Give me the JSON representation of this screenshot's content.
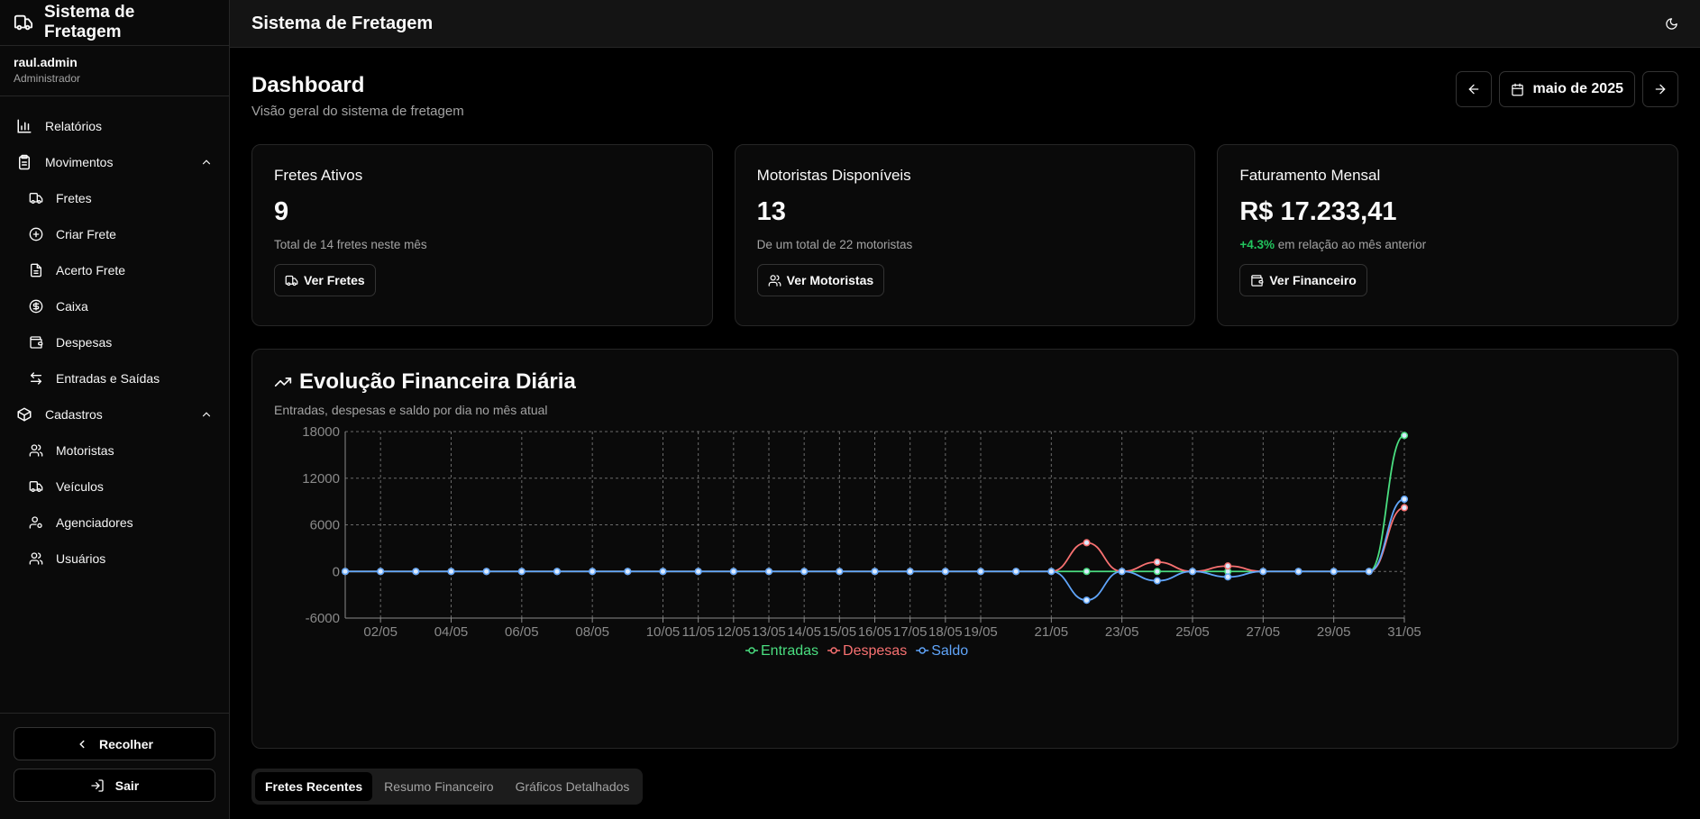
{
  "brand": {
    "title": "Sistema de Fretagem",
    "icon": "truck-icon"
  },
  "user": {
    "name": "raul.admin",
    "role": "Administrador"
  },
  "nav": {
    "relatorios": "Relatórios",
    "movimentos": "Movimentos",
    "fretes": "Fretes",
    "criar_frete": "Criar Frete",
    "acerto_frete": "Acerto Frete",
    "caixa": "Caixa",
    "despesas": "Despesas",
    "entradas_saidas": "Entradas e Saídas",
    "cadastros": "Cadastros",
    "motoristas": "Motoristas",
    "veiculos": "Veículos",
    "agenciadores": "Agenciadores",
    "usuarios": "Usuários"
  },
  "sidebar_footer": {
    "collapse": "Recolher",
    "logout": "Sair"
  },
  "topbar": {
    "title": "Sistema de Fretagem",
    "theme_icon": "moon-icon"
  },
  "page": {
    "title": "Dashboard",
    "subtitle": "Visão geral do sistema de fretagem",
    "month": "maio de 2025"
  },
  "cards": [
    {
      "label": "Fretes Ativos",
      "value": "9",
      "desc": "Total de 14 fretes neste mês",
      "button": "Ver Fretes",
      "icon": "truck-icon"
    },
    {
      "label": "Motoristas Disponíveis",
      "value": "13",
      "desc": "De um total de 22 motoristas",
      "button": "Ver Motoristas",
      "icon": "users-icon"
    },
    {
      "label": "Faturamento Mensal",
      "value": "R$ 17.233,41",
      "desc_highlight": "+4.3%",
      "desc": "em relação ao mês anterior",
      "button": "Ver Financeiro",
      "icon": "wallet-icon"
    }
  ],
  "chart_card": {
    "title": "Evolução Financeira Diária",
    "subtitle": "Entradas, despesas e saldo por dia no mês atual"
  },
  "colors": {
    "entradas": "#4ade80",
    "despesas": "#f87171",
    "saldo": "#60a5fa",
    "positive": "#22c55e"
  },
  "chart_data": {
    "type": "line",
    "x": [
      "01/05",
      "02/05",
      "03/05",
      "04/05",
      "05/05",
      "06/05",
      "07/05",
      "08/05",
      "09/05",
      "10/05",
      "11/05",
      "12/05",
      "13/05",
      "14/05",
      "15/05",
      "16/05",
      "17/05",
      "18/05",
      "19/05",
      "20/05",
      "21/05",
      "22/05",
      "23/05",
      "24/05",
      "25/05",
      "26/05",
      "27/05",
      "28/05",
      "29/05",
      "30/05",
      "31/05"
    ],
    "tick_labels": [
      "02/05",
      "04/05",
      "06/05",
      "08/05",
      "10/05",
      "11/05",
      "12/05",
      "13/05",
      "14/05",
      "15/05",
      "16/05",
      "17/05",
      "18/05",
      "19/05",
      "21/05",
      "23/05",
      "25/05",
      "27/05",
      "29/05",
      "31/05"
    ],
    "ylim": [
      -6000,
      18000
    ],
    "yticks": [
      18000,
      12000,
      6000,
      0,
      -6000
    ],
    "grid": true,
    "legend_position": "bottom-center",
    "series": [
      {
        "name": "Entradas",
        "values": [
          0,
          0,
          0,
          0,
          0,
          0,
          0,
          0,
          0,
          0,
          0,
          0,
          0,
          0,
          0,
          0,
          0,
          0,
          0,
          0,
          0,
          0,
          0,
          0,
          0,
          0,
          0,
          0,
          0,
          0,
          17500
        ]
      },
      {
        "name": "Despesas",
        "values": [
          0,
          0,
          0,
          0,
          0,
          0,
          0,
          0,
          0,
          0,
          0,
          0,
          0,
          0,
          0,
          0,
          0,
          0,
          0,
          0,
          0,
          3700,
          0,
          1200,
          0,
          700,
          0,
          0,
          0,
          0,
          8200
        ]
      },
      {
        "name": "Saldo",
        "values": [
          0,
          0,
          0,
          0,
          0,
          0,
          0,
          0,
          0,
          0,
          0,
          0,
          0,
          0,
          0,
          0,
          0,
          0,
          0,
          0,
          0,
          -3700,
          0,
          -1200,
          0,
          -700,
          0,
          0,
          0,
          0,
          9300
        ]
      }
    ]
  },
  "tabs": [
    "Fretes Recentes",
    "Resumo Financeiro",
    "Gráficos Detalhados"
  ]
}
